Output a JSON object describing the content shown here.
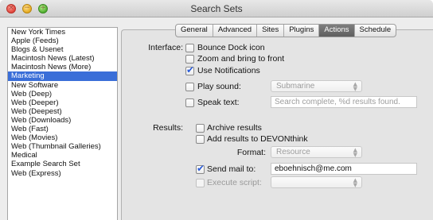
{
  "window": {
    "title": "Search Sets"
  },
  "sidebar": {
    "items": [
      {
        "label": "New York Times",
        "selected": false
      },
      {
        "label": "Apple (Feeds)",
        "selected": false
      },
      {
        "label": "Blogs & Usenet",
        "selected": false
      },
      {
        "label": "Macintosh News (Latest)",
        "selected": false
      },
      {
        "label": "Macintosh News (More)",
        "selected": false
      },
      {
        "label": "Marketing",
        "selected": true
      },
      {
        "label": "New Software",
        "selected": false
      },
      {
        "label": "Web (Deep)",
        "selected": false
      },
      {
        "label": "Web (Deeper)",
        "selected": false
      },
      {
        "label": "Web (Deepest)",
        "selected": false
      },
      {
        "label": "Web (Downloads)",
        "selected": false
      },
      {
        "label": "Web (Fast)",
        "selected": false
      },
      {
        "label": "Web (Movies)",
        "selected": false
      },
      {
        "label": "Web (Thumbnail Galleries)",
        "selected": false
      },
      {
        "label": "Medical",
        "selected": false
      },
      {
        "label": "Example Search Set",
        "selected": false
      },
      {
        "label": "Web (Express)",
        "selected": false
      }
    ]
  },
  "tabs": [
    {
      "label": "General",
      "active": false
    },
    {
      "label": "Advanced",
      "active": false
    },
    {
      "label": "Sites",
      "active": false
    },
    {
      "label": "Plugins",
      "active": false
    },
    {
      "label": "Actions",
      "active": true
    },
    {
      "label": "Schedule",
      "active": false
    }
  ],
  "interface": {
    "label": "Interface:",
    "bounce_dock_icon": {
      "label": "Bounce Dock icon",
      "checked": false
    },
    "zoom_to_front": {
      "label": "Zoom and bring to front",
      "checked": false
    },
    "use_notifications": {
      "label": "Use Notifications",
      "checked": true
    },
    "play_sound": {
      "label": "Play sound:",
      "checked": false,
      "value": "Submarine"
    },
    "speak_text": {
      "label": "Speak text:",
      "checked": false,
      "placeholder": "Search complete, %d results found."
    }
  },
  "results": {
    "label": "Results:",
    "archive_results": {
      "label": "Archive results",
      "checked": false
    },
    "add_to_devonthink": {
      "label": "Add results to DEVONthink",
      "checked": false
    },
    "format": {
      "label": "Format:",
      "value": "Resource"
    },
    "send_mail": {
      "label": "Send mail to:",
      "checked": true,
      "value": "eboehnisch@me.com"
    },
    "execute_script": {
      "label": "Execute script:",
      "checked": false,
      "value": ""
    }
  },
  "colors": {
    "selection": "#3a6ed8",
    "checkmark": "#2a5bd7"
  }
}
